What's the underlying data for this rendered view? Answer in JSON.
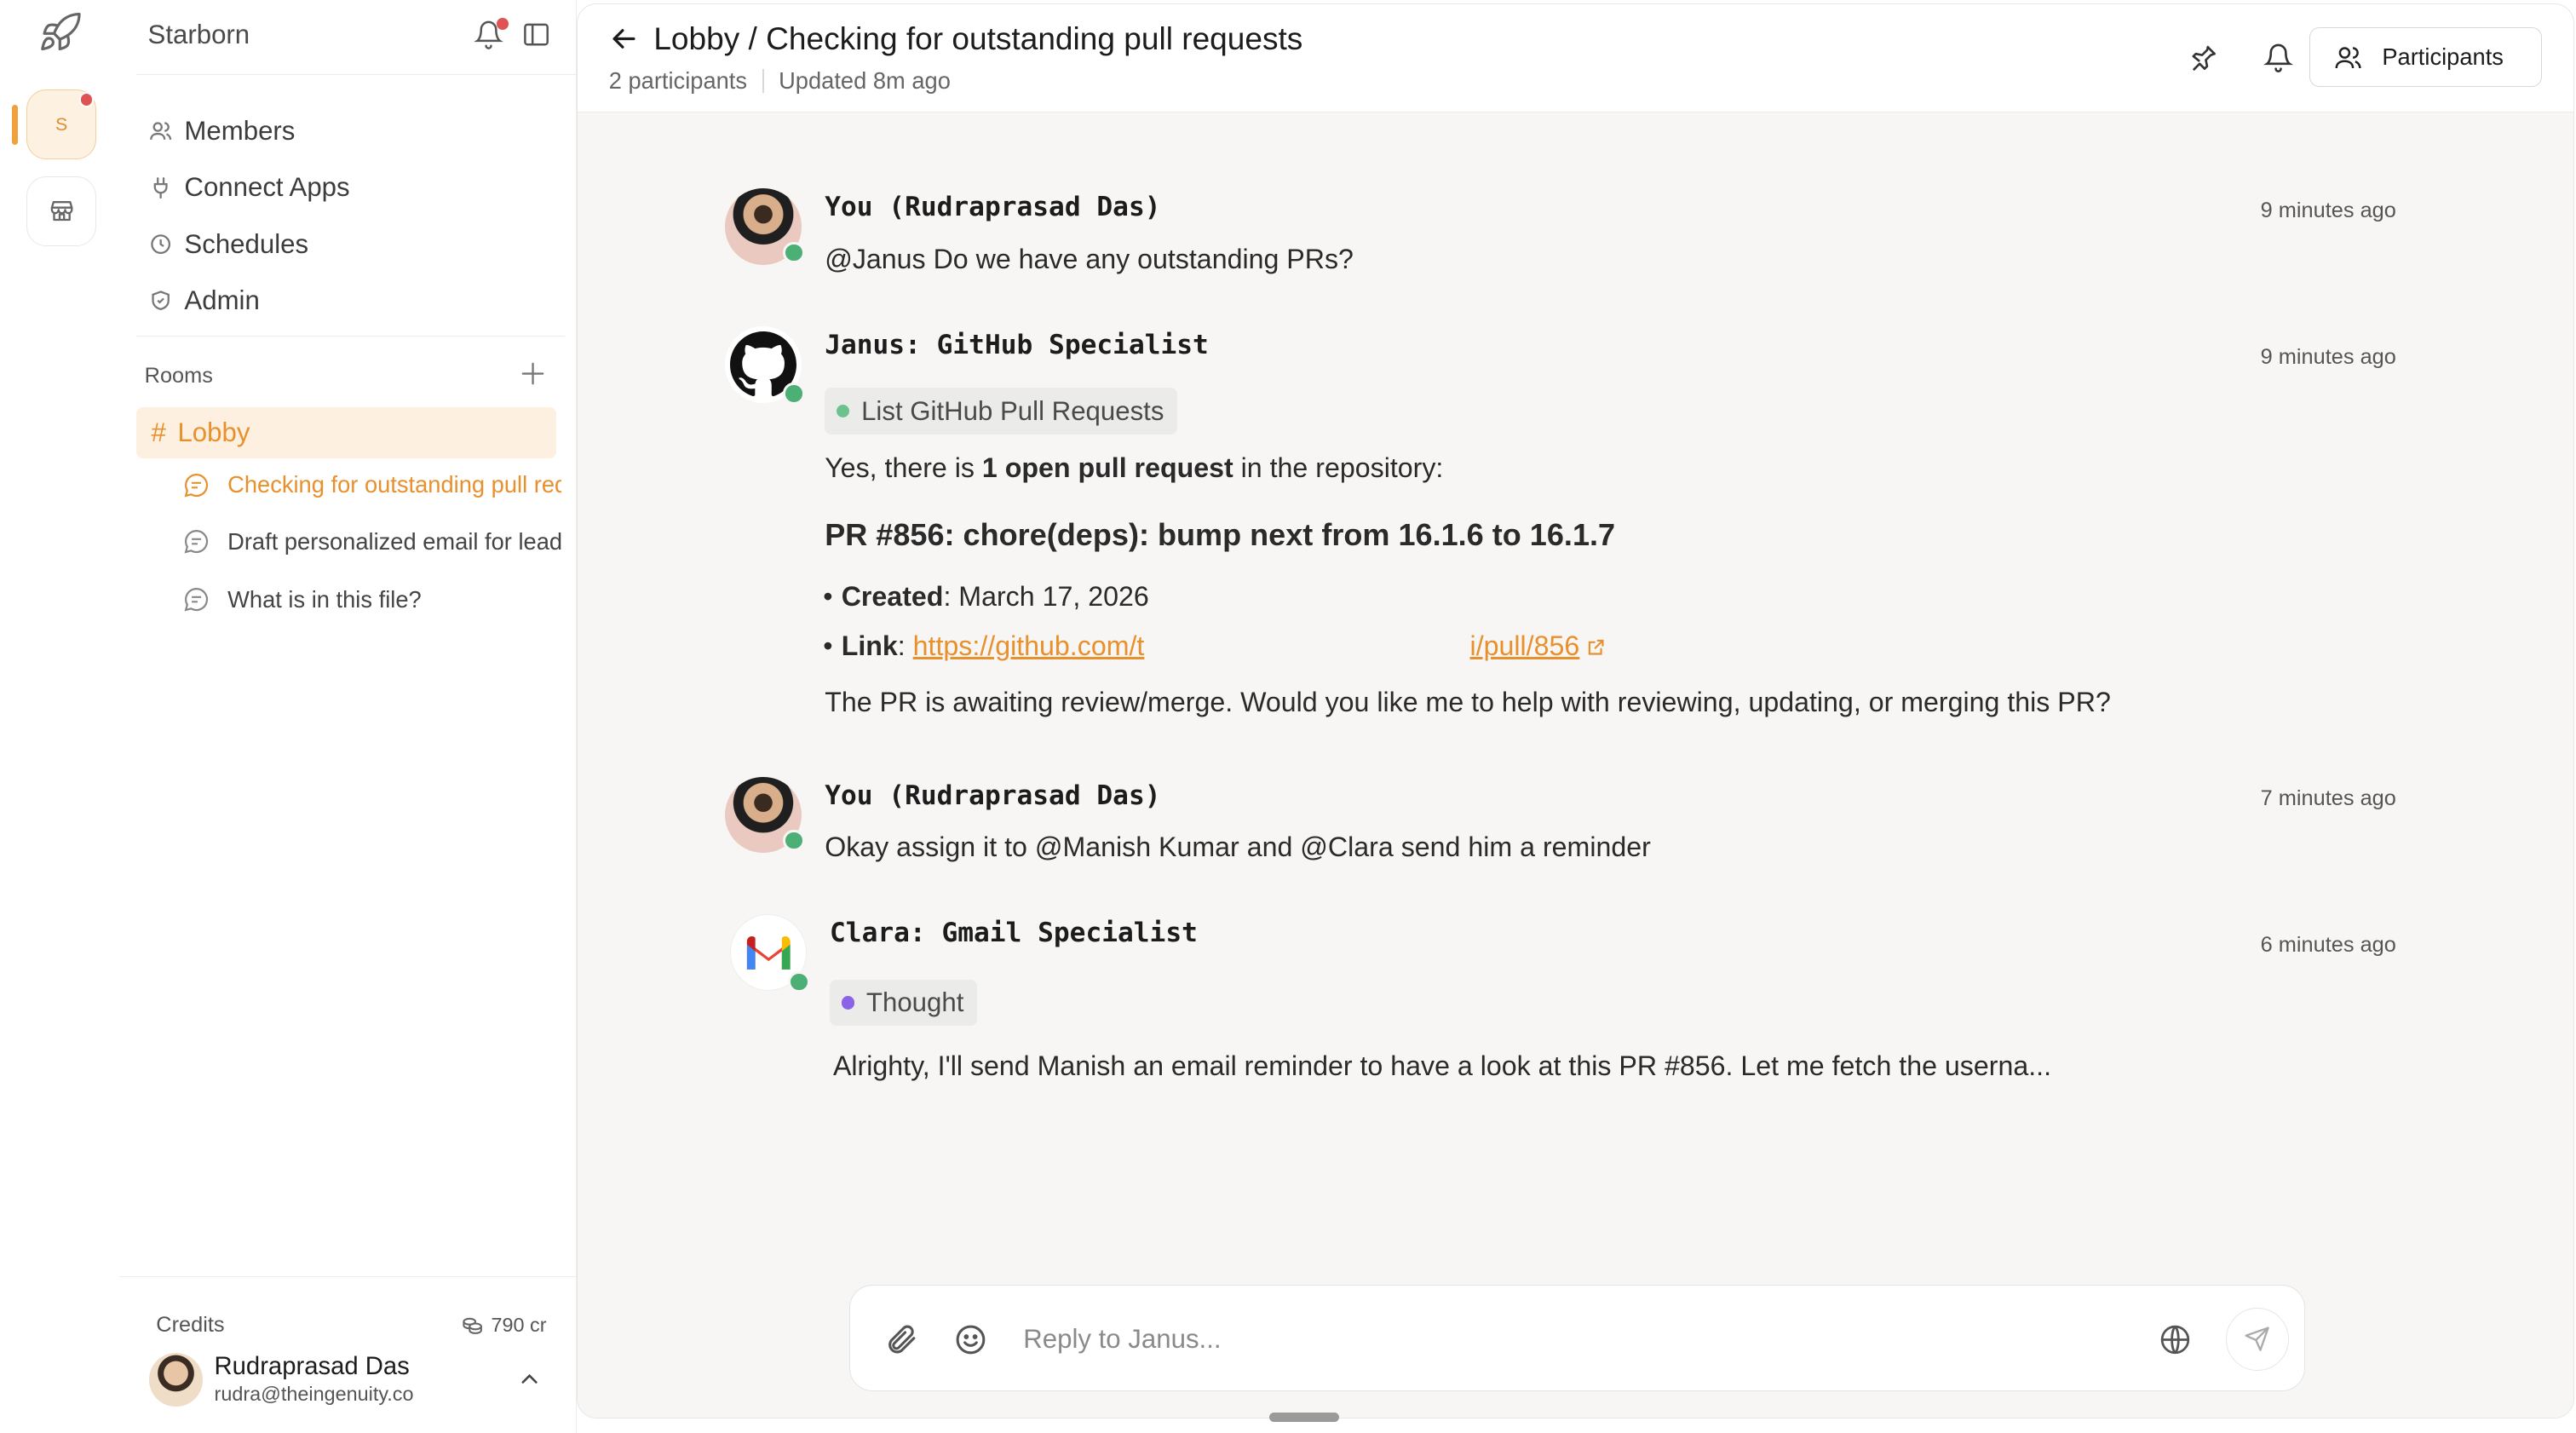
{
  "workspace": {
    "name": "Starborn",
    "rail_initial": "S"
  },
  "nav": {
    "items": [
      {
        "label": "Members",
        "icon": "users-icon"
      },
      {
        "label": "Connect Apps",
        "icon": "plug-icon"
      },
      {
        "label": "Schedules",
        "icon": "clock-icon"
      },
      {
        "label": "Admin",
        "icon": "shield-icon"
      }
    ]
  },
  "rooms": {
    "label": "Rooms",
    "lobby": {
      "hash": "#",
      "label": "Lobby"
    },
    "threads": [
      {
        "label": "Checking for outstanding pull requests",
        "active": true
      },
      {
        "label": "Draft personalized email for lead",
        "active": false
      },
      {
        "label": "What is in this file?",
        "active": false
      }
    ]
  },
  "footer": {
    "credits_label": "Credits",
    "credits_value": "790 cr",
    "user_name": "Rudraprasad Das",
    "user_email": "rudra@theingenuity.co"
  },
  "header": {
    "title": "Lobby / Checking for outstanding pull requests",
    "participants_count": "2 participants",
    "updated": "Updated 8m ago",
    "participants_button": "Participants"
  },
  "messages": {
    "m1": {
      "sender": "You (Rudraprasad Das)",
      "time": "9 minutes ago",
      "text": "@Janus Do we have any outstanding PRs?"
    },
    "m2": {
      "sender": "Janus: GitHub Specialist",
      "time": "9 minutes ago",
      "tool": "List GitHub Pull Requests",
      "intro_pre": "Yes, there is ",
      "intro_bold": "1 open pull request",
      "intro_post": " in the repository:",
      "heading": "PR #856: chore(deps): bump next from 16.1.6 to 16.1.7",
      "created_label": "Created",
      "created_value": ": March 17, 2026",
      "link_label": "Link",
      "link_sep": ": ",
      "link_text_start": "https://github.com/t",
      "link_text_end": "i/pull/856",
      "closing": "The PR is awaiting review/merge. Would you like me to help with reviewing, updating, or merging this PR?"
    },
    "m3": {
      "sender": "You (Rudraprasad Das)",
      "time": "7 minutes ago",
      "text": "Okay assign it to @Manish Kumar and @Clara send him a reminder"
    },
    "m4": {
      "sender": "Clara: Gmail Specialist",
      "time": "6 minutes ago",
      "tool": "Thought",
      "text": "Alrighty, I'll send Manish an email reminder to have a look at this PR #856. Let me fetch the userna..."
    }
  },
  "composer": {
    "placeholder": "Reply to Janus..."
  },
  "colors": {
    "accent": "#e8902c",
    "online": "#4caf76",
    "tool_dot_green": "#6cc28e",
    "tool_dot_purple": "#8a63e8",
    "alert": "#e05353"
  }
}
